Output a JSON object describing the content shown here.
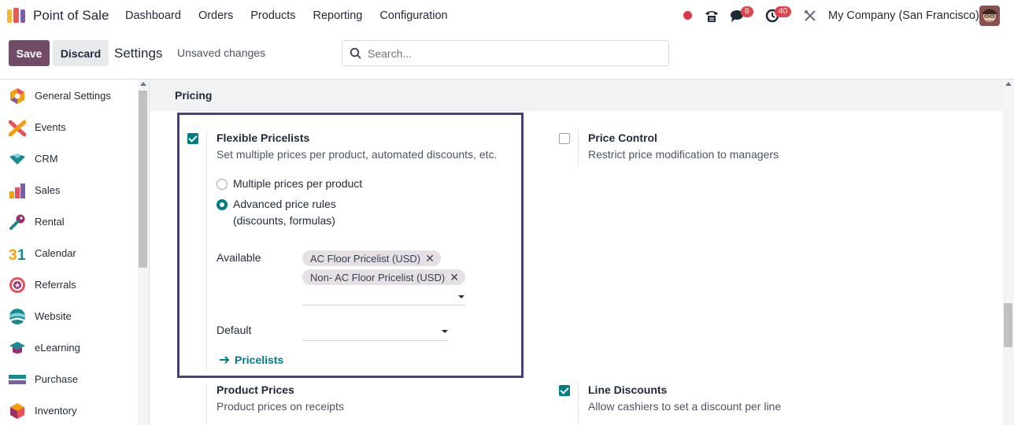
{
  "navbar": {
    "app_name": "Point of Sale",
    "menu": [
      "Dashboard",
      "Orders",
      "Products",
      "Reporting",
      "Configuration"
    ],
    "messages_count": "8",
    "activities_count": "40",
    "company": "My Company (San Francisco)"
  },
  "control": {
    "save_label": "Save",
    "discard_label": "Discard",
    "title": "Settings",
    "status": "Unsaved changes",
    "search_placeholder": "Search..."
  },
  "sidebar": {
    "items": [
      {
        "label": "General Settings",
        "icon": "general-settings-icon"
      },
      {
        "label": "Events",
        "icon": "events-icon"
      },
      {
        "label": "CRM",
        "icon": "crm-icon"
      },
      {
        "label": "Sales",
        "icon": "sales-icon"
      },
      {
        "label": "Rental",
        "icon": "rental-icon"
      },
      {
        "label": "Calendar",
        "icon": "calendar-icon"
      },
      {
        "label": "Referrals",
        "icon": "referrals-icon"
      },
      {
        "label": "Website",
        "icon": "website-icon"
      },
      {
        "label": "eLearning",
        "icon": "elearning-icon"
      },
      {
        "label": "Purchase",
        "icon": "purchase-icon"
      },
      {
        "label": "Inventory",
        "icon": "inventory-icon"
      }
    ]
  },
  "pricing": {
    "section_title": "Pricing",
    "flexible": {
      "title": "Flexible Pricelists",
      "desc": "Set multiple prices per product, automated discounts, etc.",
      "checked": true,
      "option1": "Multiple prices per product",
      "option2_line1": "Advanced price rules",
      "option2_line2": "(discounts, formulas)",
      "available_label": "Available",
      "tags": [
        "AC Floor Pricelist (USD)",
        "Non- AC Floor Pricelist (USD)"
      ],
      "default_label": "Default",
      "link": "Pricelists"
    },
    "price_control": {
      "title": "Price Control",
      "desc": "Restrict price modification to managers",
      "checked": false
    },
    "product_prices": {
      "title": "Product Prices",
      "desc": "Product prices on receipts"
    },
    "line_discounts": {
      "title": "Line Discounts",
      "desc": "Allow cashiers to set a discount per line",
      "checked": true
    }
  },
  "colors": {
    "brand": "#714b67",
    "accent": "#017e84",
    "highlight_border": "#4a3f7a"
  }
}
